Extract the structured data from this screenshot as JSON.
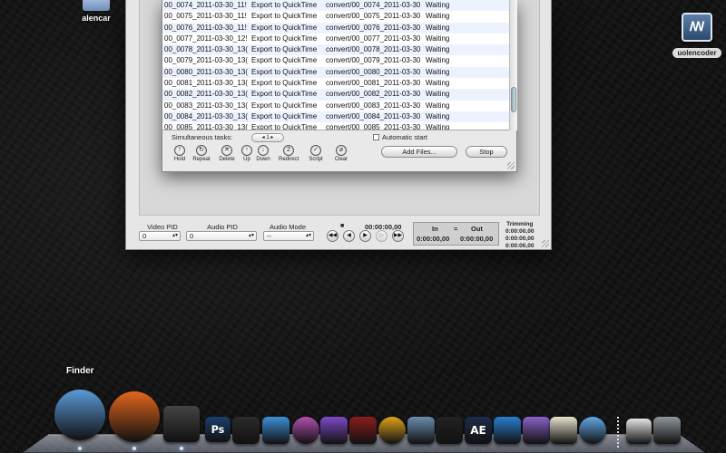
{
  "desktop": {
    "icons": [
      {
        "label": "alencar"
      },
      {
        "label": "uolencoder"
      }
    ]
  },
  "batch": {
    "rows": [
      [
        "00_0074_2011-03-30_11!",
        "Export to QuickTime",
        "convert/00_0074_2011-03-30",
        "Waiting"
      ],
      [
        "00_0075_2011-03-30_11!",
        "Export to QuickTime",
        "convert/00_0075_2011-03-30",
        "Waiting"
      ],
      [
        "00_0076_2011-03-30_11!",
        "Export to QuickTime",
        "convert/00_0076_2011-03-30",
        "Waiting"
      ],
      [
        "00_0077_2011-03-30_12!",
        "Export to QuickTime",
        "convert/00_0077_2011-03-30",
        "Waiting"
      ],
      [
        "00_0078_2011-03-30_13(",
        "Export to QuickTime",
        "convert/00_0078_2011-03-30",
        "Waiting"
      ],
      [
        "00_0079_2011-03-30_13(",
        "Export to QuickTime",
        "convert/00_0079_2011-03-30",
        "Waiting"
      ],
      [
        "00_0080_2011-03-30_13(",
        "Export to QuickTime",
        "convert/00_0080_2011-03-30",
        "Waiting"
      ],
      [
        "00_0081_2011-03-30_13(",
        "Export to QuickTime",
        "convert/00_0081_2011-03-30",
        "Waiting"
      ],
      [
        "00_0082_2011-03-30_13(",
        "Export to QuickTime",
        "convert/00_0082_2011-03-30",
        "Waiting"
      ],
      [
        "00_0083_2011-03-30_13(",
        "Export to QuickTime",
        "convert/00_0083_2011-03-30",
        "Waiting"
      ],
      [
        "00_0084_2011-03-30_13(",
        "Export to QuickTime",
        "convert/00_0084_2011-03-30",
        "Waiting"
      ],
      [
        "00_0085_2011-03-30_13(",
        "Export to QuickTime",
        "convert/00_0085_2011-03-30",
        "Waiting"
      ]
    ],
    "simultaneous_label": "Simultaneous tasks:",
    "simultaneous_value": "1",
    "auto_start_label": "Automatic start",
    "tools": [
      {
        "label": "Hold",
        "icon": "!"
      },
      {
        "label": "Repeat",
        "icon": "↻"
      },
      {
        "label": "Delete",
        "icon": "✕"
      },
      {
        "label": "Up",
        "icon": "↑"
      },
      {
        "label": "Down",
        "icon": "↓"
      },
      {
        "label": "Redirect",
        "icon": "2"
      },
      {
        "label": "Script",
        "icon": "✓"
      },
      {
        "label": "Clear",
        "icon": "⌀"
      }
    ],
    "add_files_label": "Add Files...",
    "stop_label": "Stop"
  },
  "player": {
    "video_pid_label": "Video PID",
    "video_pid_value": "0",
    "audio_pid_label": "Audio PID",
    "audio_pid_value": "0",
    "audio_mode_label": "Audio Mode",
    "audio_mode_value": "--",
    "stop_glyph": "■",
    "timecode": "00:00:00,00",
    "in_label": "In",
    "in_value": "0:00:00,00",
    "eq_glyph": "=",
    "out_label": "Out",
    "out_value": "0:00:00,00",
    "trimming_label": "Trimming",
    "trim_1": "0:00:00,00",
    "trim_2": "0:00:00,00",
    "trim_3": "0:00:00,00"
  },
  "dock": {
    "tooltip": "Finder",
    "apps": [
      {
        "icon": "finder-icon",
        "color": "#5b9ad8"
      },
      {
        "icon": "firefox-icon",
        "color": "#e2661c"
      },
      {
        "icon": "clapper-icon",
        "color": "#444444"
      },
      {
        "icon": "photoshop-icon",
        "color": "#1d3e6b",
        "text": "Ps"
      },
      {
        "icon": "filmstrip-icon",
        "color": "#2b2b2b"
      },
      {
        "icon": "messenger-icon",
        "color": "#3f8fd6"
      },
      {
        "icon": "color-wheel-icon",
        "color": "#b34fb1"
      },
      {
        "icon": "motion-icon",
        "color": "#7d4ac8"
      },
      {
        "icon": "pdf-icon",
        "color": "#8a1d1d"
      },
      {
        "icon": "dvd-icon",
        "color": "#e0a21c"
      },
      {
        "icon": "preview-icon",
        "color": "#6c8db0"
      },
      {
        "icon": "final-cut-icon",
        "color": "#222222"
      },
      {
        "icon": "after-effects-icon",
        "color": "#1f2b4a",
        "text": "AE"
      },
      {
        "icon": "dvd-player-icon",
        "color": "#2a7fcf"
      },
      {
        "icon": "dvd-studio-icon",
        "color": "#8b62c9"
      },
      {
        "icon": "textedit-icon",
        "color": "#e8e2cc"
      },
      {
        "icon": "itunes-icon",
        "color": "#62a8e8"
      },
      {
        "icon": "document-icon",
        "color": "#e5e5e5"
      },
      {
        "icon": "trash-icon",
        "color": "#8f969c"
      }
    ]
  }
}
